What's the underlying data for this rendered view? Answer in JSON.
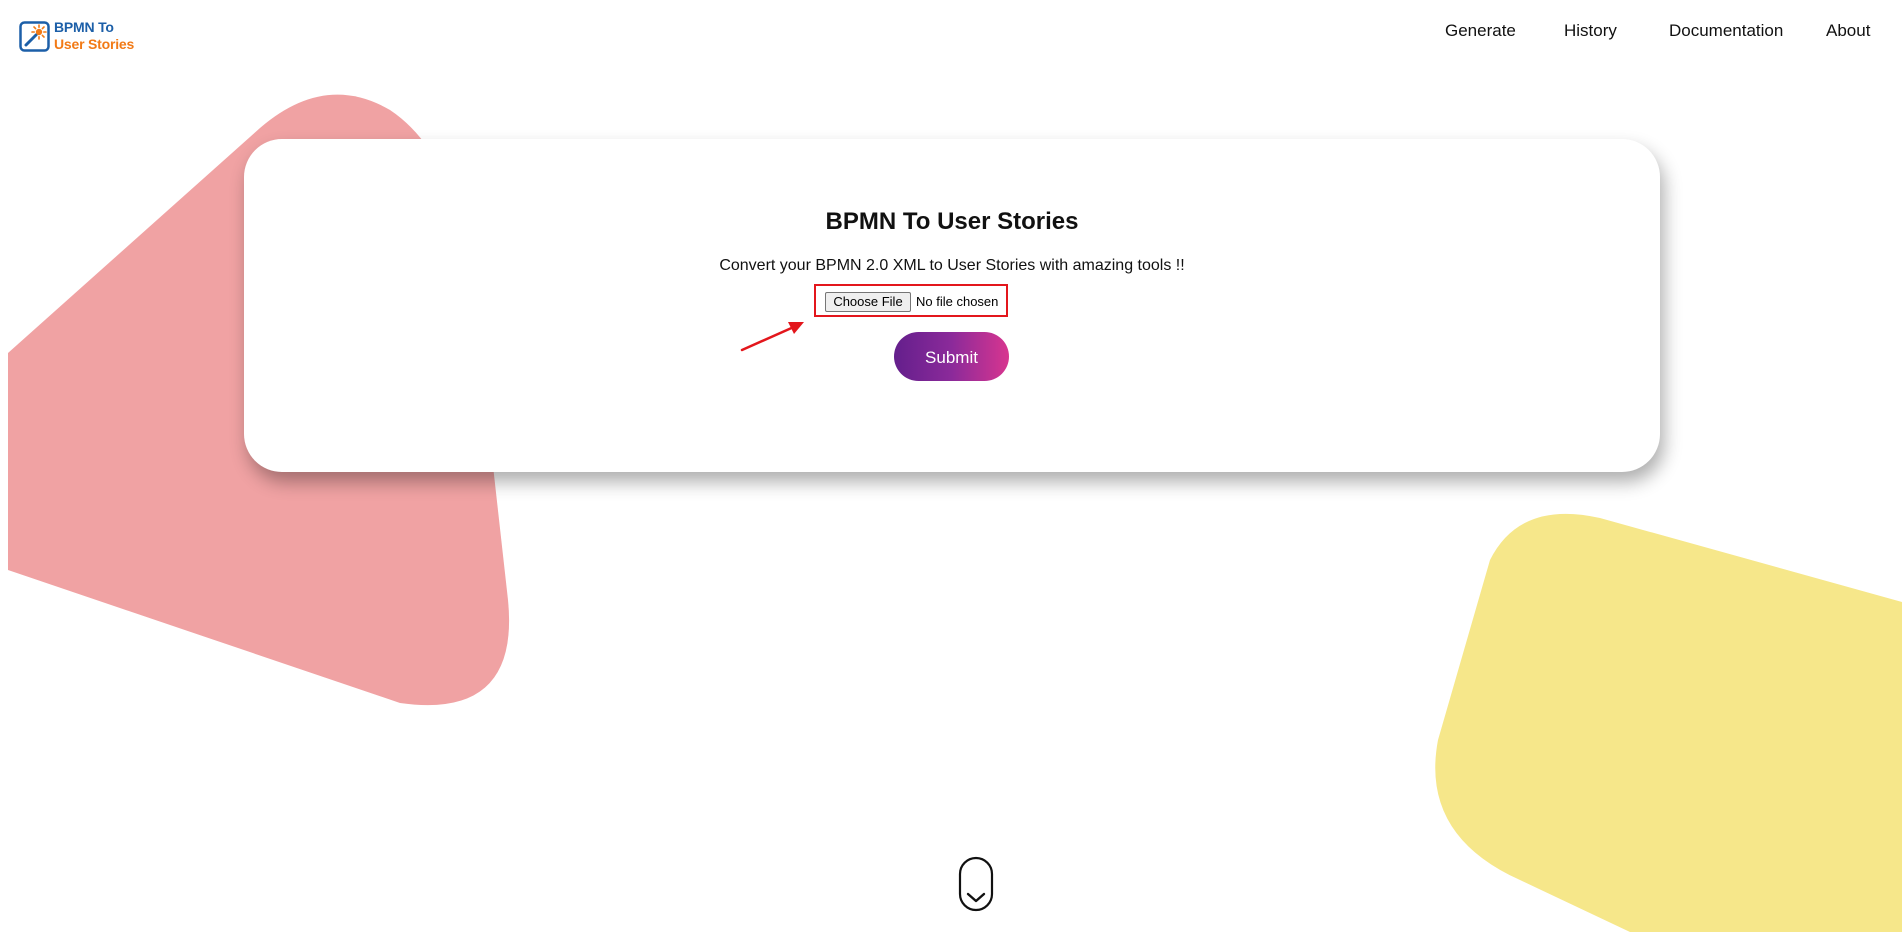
{
  "brand": {
    "line1": "BPMN To",
    "line2": "User Stories",
    "blue": "#1c5fa8",
    "orange": "#f27a16",
    "icon": "magic-wand-icon"
  },
  "nav": {
    "items": [
      {
        "label": "Generate"
      },
      {
        "label": "History"
      },
      {
        "label": "Documentation"
      },
      {
        "label": "About"
      }
    ]
  },
  "main": {
    "title": "BPMN To User Stories",
    "subtitle": "Convert your BPMN 2.0 XML to User Stories with amazing tools !!",
    "file_input": {
      "button_label": "Choose File",
      "status": "No file chosen"
    },
    "submit_label": "Submit"
  },
  "colors": {
    "pink_shape": "#f0a2a3",
    "yellow_shape": "#f6e78a",
    "submit_gradient_start": "#641f8c",
    "submit_gradient_end": "#d8358f",
    "highlight_red": "#e3161c"
  },
  "icons": {
    "scroll_indicator": "chevron-down-icon",
    "annotation": "arrow-icon"
  }
}
